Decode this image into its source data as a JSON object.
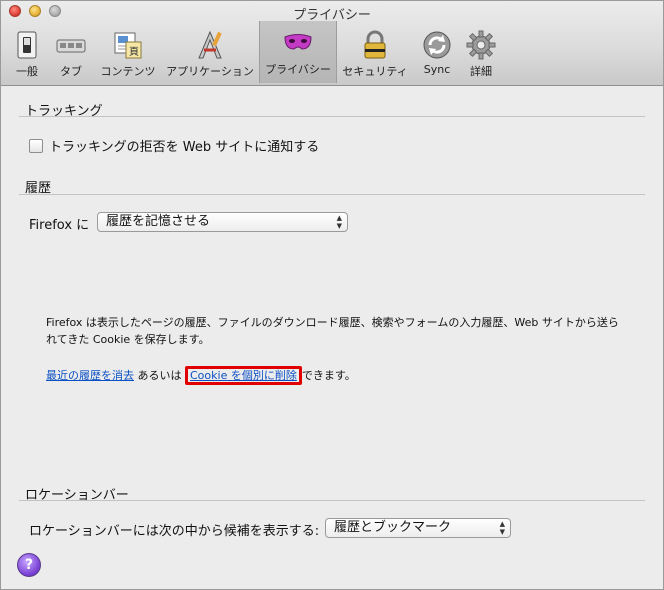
{
  "window": {
    "title": "プライバシー"
  },
  "toolbar": {
    "items": [
      {
        "label": "一般",
        "icon": "switch-icon"
      },
      {
        "label": "タブ",
        "icon": "tabs-icon"
      },
      {
        "label": "コンテンツ",
        "icon": "content-icon"
      },
      {
        "label": "アプリケーション",
        "icon": "applications-icon"
      },
      {
        "label": "プライバシー",
        "icon": "mask-icon",
        "selected": true
      },
      {
        "label": "セキュリティ",
        "icon": "padlock-icon"
      },
      {
        "label": "Sync",
        "icon": "sync-icon"
      },
      {
        "label": "詳細",
        "icon": "gear-icon"
      }
    ]
  },
  "tracking": {
    "title": "トラッキング",
    "checkbox_label": "トラッキングの拒否を Web サイトに通知する"
  },
  "history": {
    "title": "履歴",
    "prefix": "Firefox に",
    "select_value": "履歴を記憶させる",
    "description": "Firefox は表示したページの履歴、ファイルのダウンロード履歴、検索やフォームの入力履歴、Web サイトから送られてきた Cookie を保存します。",
    "link_clear": "最近の履歴を消去",
    "text_or": "あるいは",
    "link_cookies": "Cookie を個別に削除",
    "text_end": "できます。"
  },
  "location_bar": {
    "title": "ロケーションバー",
    "label": "ロケーションバーには次の中から候補を表示する:",
    "select_value": "履歴とブックマーク"
  },
  "help": {
    "label": "?"
  },
  "colors": {
    "highlight": "#e00000",
    "link": "#0a4fc4"
  }
}
